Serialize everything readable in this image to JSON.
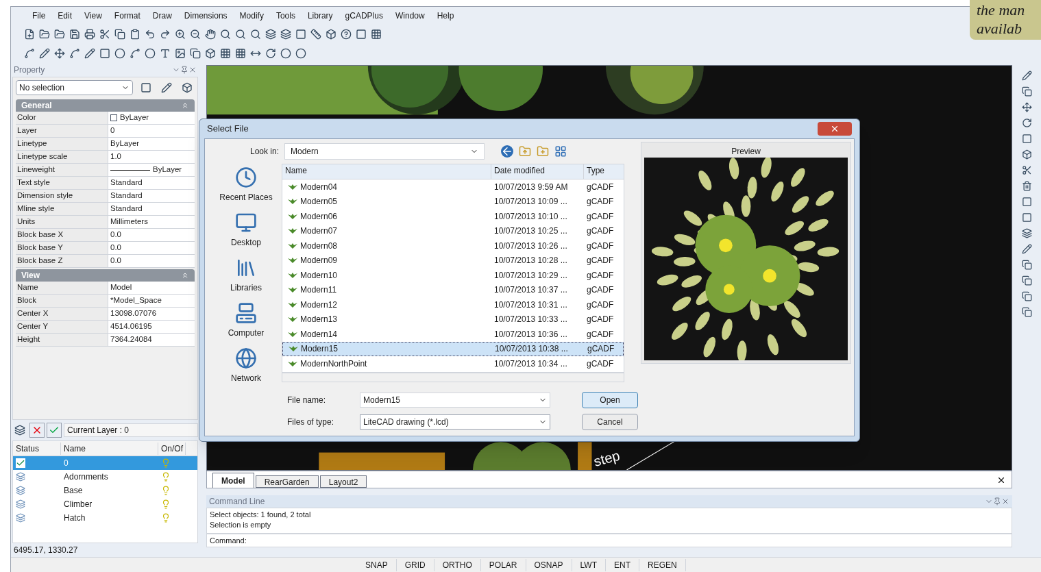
{
  "menu_bar": [
    "File",
    "Edit",
    "View",
    "Format",
    "Draw",
    "Dimensions",
    "Modify",
    "Tools",
    "Library",
    "gCADPlus",
    "Window",
    "Help"
  ],
  "note": [
    "the man",
    "availab"
  ],
  "property_panel": {
    "title": "Property",
    "selection": "No selection",
    "sections": [
      {
        "title": "General",
        "expanded": true,
        "rows": [
          {
            "label": "Color",
            "value": "ByLayer",
            "kind": "swatch"
          },
          {
            "label": "Layer",
            "value": "0",
            "kind": "text"
          },
          {
            "label": "Linetype",
            "value": "ByLayer",
            "kind": "text"
          },
          {
            "label": "Linetype scale",
            "value": "1.0",
            "kind": "text"
          },
          {
            "label": "Lineweight",
            "value": "ByLayer",
            "kind": "line"
          },
          {
            "label": "Text style",
            "value": "Standard",
            "kind": "text"
          },
          {
            "label": "Dimension style",
            "value": "Standard",
            "kind": "text"
          },
          {
            "label": "Mline style",
            "value": "Standard",
            "kind": "text"
          },
          {
            "label": "Units",
            "value": "Millimeters",
            "kind": "text"
          },
          {
            "label": "Block base X",
            "value": "0.0",
            "kind": "text"
          },
          {
            "label": "Block base Y",
            "value": "0.0",
            "kind": "text"
          },
          {
            "label": "Block base Z",
            "value": "0.0",
            "kind": "text"
          }
        ]
      },
      {
        "title": "View",
        "expanded": true,
        "rows": [
          {
            "label": "Name",
            "value": "Model",
            "kind": "text"
          },
          {
            "label": "Block",
            "value": "*Model_Space",
            "kind": "text"
          },
          {
            "label": "Center X",
            "value": "13098.07076",
            "kind": "text"
          },
          {
            "label": "Center Y",
            "value": "4514.06195",
            "kind": "text"
          },
          {
            "label": "Height",
            "value": "7364.24084",
            "kind": "text"
          }
        ]
      }
    ]
  },
  "layer_panel": {
    "current_layer": "Current Layer : 0",
    "columns": [
      "Status",
      "Name",
      "On/Of"
    ],
    "rows": [
      {
        "name": "0",
        "current": true,
        "selected": true
      },
      {
        "name": "Adornments",
        "current": false,
        "selected": false
      },
      {
        "name": "Base",
        "current": false,
        "selected": false
      },
      {
        "name": "Climber",
        "current": false,
        "selected": false
      },
      {
        "name": "Hatch",
        "current": false,
        "selected": false
      }
    ]
  },
  "coordinates": "6495.17, 1330.27",
  "drawing_labels": [
    "step"
  ],
  "dialog": {
    "title": "Select File",
    "look_in_label": "Look in:",
    "look_in": "Modern",
    "places": [
      "Recent Places",
      "Desktop",
      "Libraries",
      "Computer",
      "Network"
    ],
    "columns": [
      "Name",
      "Date modified",
      "Type"
    ],
    "files": [
      {
        "name": "Modern04",
        "date": "10/07/2013 9:59 AM",
        "type": "gCADF",
        "selected": false
      },
      {
        "name": "Modern05",
        "date": "10/07/2013 10:09 ...",
        "type": "gCADF",
        "selected": false
      },
      {
        "name": "Modern06",
        "date": "10/07/2013 10:10 ...",
        "type": "gCADF",
        "selected": false
      },
      {
        "name": "Modern07",
        "date": "10/07/2013 10:25 ...",
        "type": "gCADF",
        "selected": false
      },
      {
        "name": "Modern08",
        "date": "10/07/2013 10:26 ...",
        "type": "gCADF",
        "selected": false
      },
      {
        "name": "Modern09",
        "date": "10/07/2013 10:28 ...",
        "type": "gCADF",
        "selected": false
      },
      {
        "name": "Modern10",
        "date": "10/07/2013 10:29 ...",
        "type": "gCADF",
        "selected": false
      },
      {
        "name": "Modern11",
        "date": "10/07/2013 10:37 ...",
        "type": "gCADF",
        "selected": false
      },
      {
        "name": "Modern12",
        "date": "10/07/2013 10:31 ...",
        "type": "gCADF",
        "selected": false
      },
      {
        "name": "Modern13",
        "date": "10/07/2013 10:33 ...",
        "type": "gCADF",
        "selected": false
      },
      {
        "name": "Modern14",
        "date": "10/07/2013 10:36 ...",
        "type": "gCADF",
        "selected": false
      },
      {
        "name": "Modern15",
        "date": "10/07/2013 10:38 ...",
        "type": "gCADF",
        "selected": true
      },
      {
        "name": "ModernNorthPoint",
        "date": "10/07/2013 10:34 ...",
        "type": "gCADF",
        "selected": false
      }
    ],
    "file_name_label": "File name:",
    "file_name": "Modern15",
    "files_of_type_label": "Files of type:",
    "files_of_type": "LiteCAD drawing (*.lcd)",
    "open": "Open",
    "cancel": "Cancel",
    "preview_label": "Preview"
  },
  "layout_tabs": [
    {
      "label": "Model",
      "selected": true
    },
    {
      "label": "RearGarden",
      "selected": false
    },
    {
      "label": "Layout2",
      "selected": false
    }
  ],
  "command_line": {
    "title": "Command Line",
    "history": [
      "Select objects: 1 found,  2 total",
      "Selection is empty"
    ],
    "prompt": "Command:"
  },
  "status_buttons": [
    "SNAP",
    "GRID",
    "ORTHO",
    "POLAR",
    "OSNAP",
    "LWT",
    "ENT",
    "REGEN"
  ]
}
